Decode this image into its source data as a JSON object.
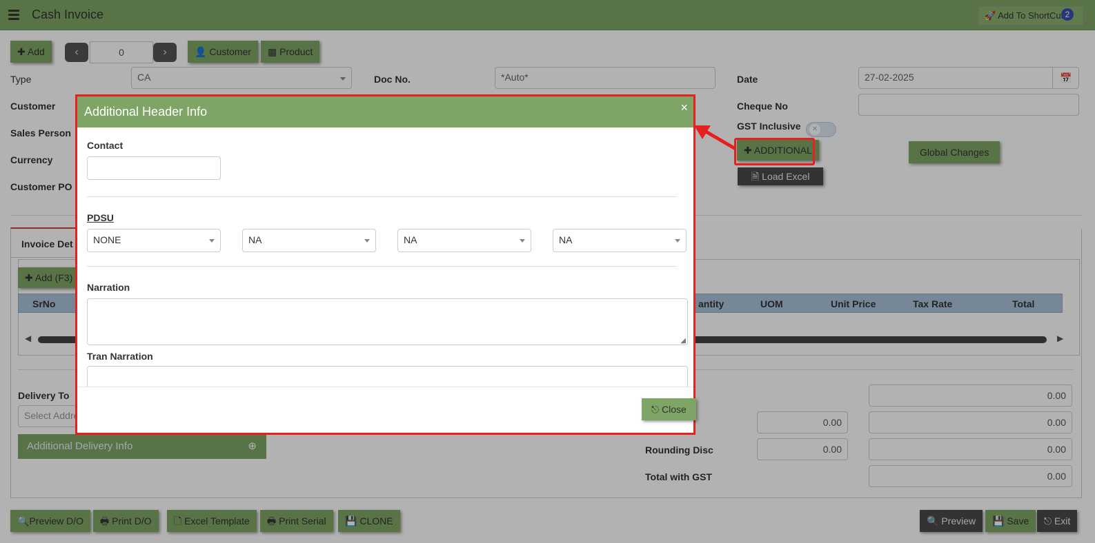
{
  "app": {
    "title": "Cash Invoice",
    "shortcut_label": "Add To ShortCut",
    "shortcut_badge": "2"
  },
  "toolbar": {
    "add_label": "Add",
    "pager_value": "0",
    "customer_label": "Customer",
    "product_label": "Product"
  },
  "header_form": {
    "type_label": "Type",
    "type_value": "CA",
    "doc_no_label": "Doc No.",
    "doc_no_value": "*Auto*",
    "date_label": "Date",
    "date_value": "27-02-2025",
    "customer_label": "Customer",
    "cheque_no_label": "Cheque No",
    "cheque_no_value": "",
    "sales_person_label": "Sales Person",
    "gst_inclusive_label": "GST Inclusive",
    "currency_label": "Currency",
    "customer_po_label": "Customer PO",
    "additional_label": "ADDITIONAL",
    "global_changes_label": "Global Changes",
    "load_excel_label": "Load Excel"
  },
  "invoice_details": {
    "tab_label": "Invoice Det",
    "add_row_label": "Add (F3)",
    "columns": [
      "SrNo",
      "antity",
      "UOM",
      "Unit Price",
      "Tax Rate",
      "Total"
    ]
  },
  "delivery": {
    "delivery_to_label": "Delivery To",
    "address_placeholder": "Select Addre",
    "additional_delivery_label": "Additional Delivery Info"
  },
  "totals": {
    "row1_total": "0.00",
    "row2_pct": "0.00",
    "row2_total": "0.00",
    "rounding_label": "Rounding Disc",
    "rounding_pct": "0.00",
    "rounding_total": "0.00",
    "total_gst_label": "Total with GST",
    "total_gst_value": "0.00"
  },
  "footer": {
    "preview_do": "Preview D/O",
    "print_do": "Print D/O",
    "excel_template": "Excel Template",
    "print_serial": "Print Serial",
    "clone": "CLONE",
    "preview": "Preview",
    "save": "Save",
    "exit": "Exit"
  },
  "modal": {
    "title": "Additional Header Info",
    "close_x": "×",
    "contact_label": "Contact",
    "contact_value": "",
    "pdsu_label": "PDSU",
    "pdsu_selects": [
      "NONE",
      "NA",
      "NA",
      "NA"
    ],
    "narration_label": "Narration",
    "narration_value": "",
    "tran_narration_label": "Tran Narration",
    "close_label": "Close"
  },
  "colors": {
    "accent_green": "#7ea565",
    "annotation_red": "#e52020",
    "grid_header": "#a9c3d8"
  }
}
